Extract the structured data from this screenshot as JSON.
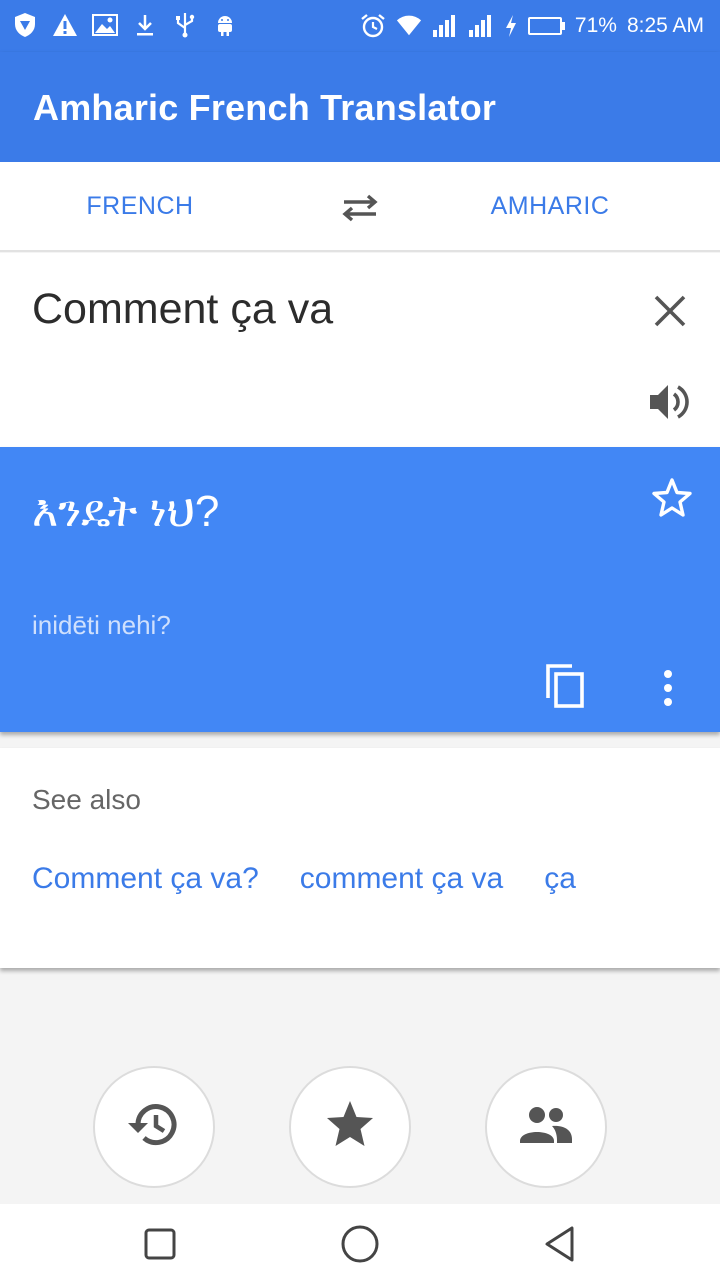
{
  "status_bar": {
    "icons_left": [
      "shield-icon",
      "warning-icon",
      "image-icon",
      "download-icon",
      "usb-icon",
      "android-icon"
    ],
    "icons_right": [
      "alarm-icon",
      "wifi-icon",
      "signal-icon",
      "signal-icon",
      "charging-icon",
      "battery-icon"
    ],
    "battery_percent": "71%",
    "battery_level": 0.71,
    "time": "8:25 AM"
  },
  "app_bar": {
    "title": "Amharic French Translator"
  },
  "lang_bar": {
    "source": "FRENCH",
    "target": "AMHARIC",
    "swap_icon": "swap-arrows-icon"
  },
  "input": {
    "text": "Comment ça va",
    "clear_icon": "close-icon",
    "speak_icon": "speaker-icon"
  },
  "result": {
    "text": "እንዴት ነህ?",
    "transliteration": "inidēti nehi?",
    "star_icon": "star-outline-icon",
    "copy_icon": "copy-icon",
    "more_icon": "more-vertical-icon"
  },
  "see_also": {
    "title": "See also",
    "links": [
      "Comment ça va?",
      "comment ça va",
      "ça"
    ]
  },
  "fabs": [
    "history-icon",
    "star-icon",
    "people-icon"
  ],
  "nav_bar": [
    "recent-apps-icon",
    "home-icon",
    "back-icon"
  ],
  "colors": {
    "primary": "#3b7be8",
    "result_bg": "#4287f5",
    "link": "#3b7be8",
    "background": "#f4f4f4"
  }
}
